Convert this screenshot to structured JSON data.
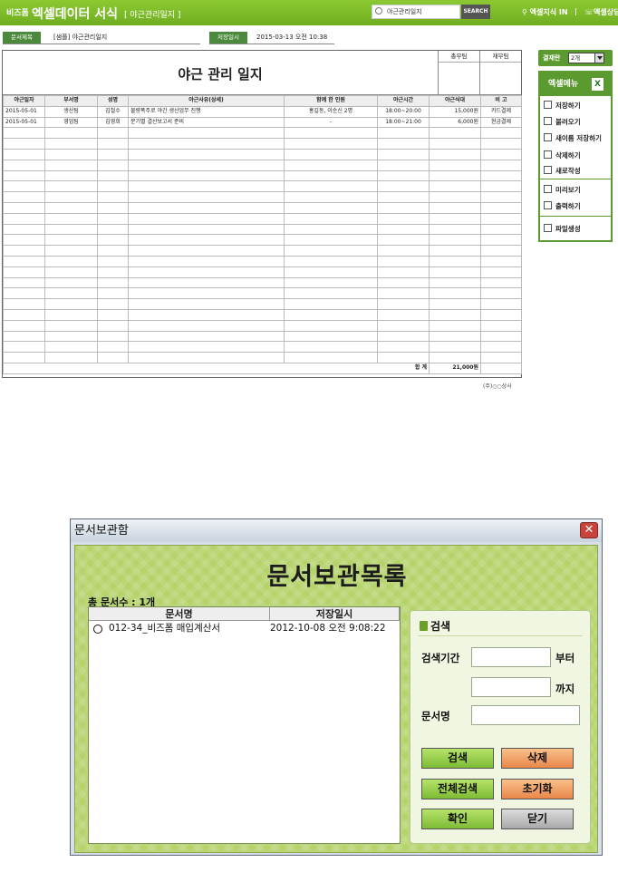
{
  "topbar": {
    "brand_small": "비즈폼",
    "brand": "엑셀데이터 서식",
    "brand_sub": "[ 야근관리일지 ]",
    "search_value": "야근관리일지",
    "search_button": "SEARCH",
    "link1": "엑셀지식 IN",
    "separator": "|",
    "link2": "엑셀상담"
  },
  "doc_header": {
    "title_label": "문서제목",
    "title_value": "[샘플] 야근관리일지",
    "saved_label": "저장일시",
    "saved_value": "2015-03-13  오전 10:38"
  },
  "form": {
    "title": "야근 관리 일지",
    "approval": [
      "총무팀",
      "재무팀"
    ],
    "columns": [
      "야근일자",
      "부서명",
      "성명",
      "야근사유(상세)",
      "함께 한 인원",
      "야근시간",
      "야근식대",
      "비 고"
    ],
    "rows": [
      [
        "2015-05-01",
        "생산팀",
        "김철수",
        "물량폭주로 야간 생산업무 진행",
        "홍길동, 이순신 2명",
        "18:00~20:00",
        "15,000원",
        "카드결제"
      ],
      [
        "2015-05-01",
        "영업팀",
        "김영희",
        "분기별 결산보고서 준비",
        "-",
        "18:00~21:00",
        "6,000원",
        "현금결제"
      ]
    ],
    "total_label": "합  계",
    "total_value": "21,000원",
    "footnote": "(주)○○상사"
  },
  "sidebar": {
    "approval_label": "결재란",
    "approval_select": "2개",
    "menu_title": "엑셀메뉴",
    "excel_icon": "X",
    "items": [
      {
        "label": "저장하기",
        "icon": "save-icon"
      },
      {
        "label": "불러오기",
        "icon": "load-icon"
      },
      {
        "label": "새이름 저장하기",
        "icon": "save-as-icon"
      },
      {
        "label": "삭제하기",
        "icon": "delete-icon"
      },
      {
        "label": "새로작성",
        "icon": "new-icon"
      },
      {
        "label": "미리보기",
        "icon": "preview-icon"
      },
      {
        "label": "출력하기",
        "icon": "print-icon"
      },
      {
        "label": "파일생성",
        "icon": "folder-icon"
      }
    ]
  },
  "dialog": {
    "window_title": "문서보관함",
    "close": "✕",
    "heading": "문서보관목록",
    "count": "총 문서수 : 1개",
    "list_headers": [
      "문서명",
      "저장일시"
    ],
    "list_row": {
      "name": "012-34_비즈폼 매입계산서",
      "saved": "2012-10-08 오전 9:08:22"
    },
    "search": {
      "title": "검색",
      "period_label": "검색기간",
      "from_suffix": "부터",
      "to_suffix": "까지",
      "name_label": "문서명"
    },
    "buttons": {
      "search": "검색",
      "delete": "삭제",
      "search_all": "전체검색",
      "reset": "초기화",
      "ok": "확인",
      "close": "닫기"
    }
  }
}
